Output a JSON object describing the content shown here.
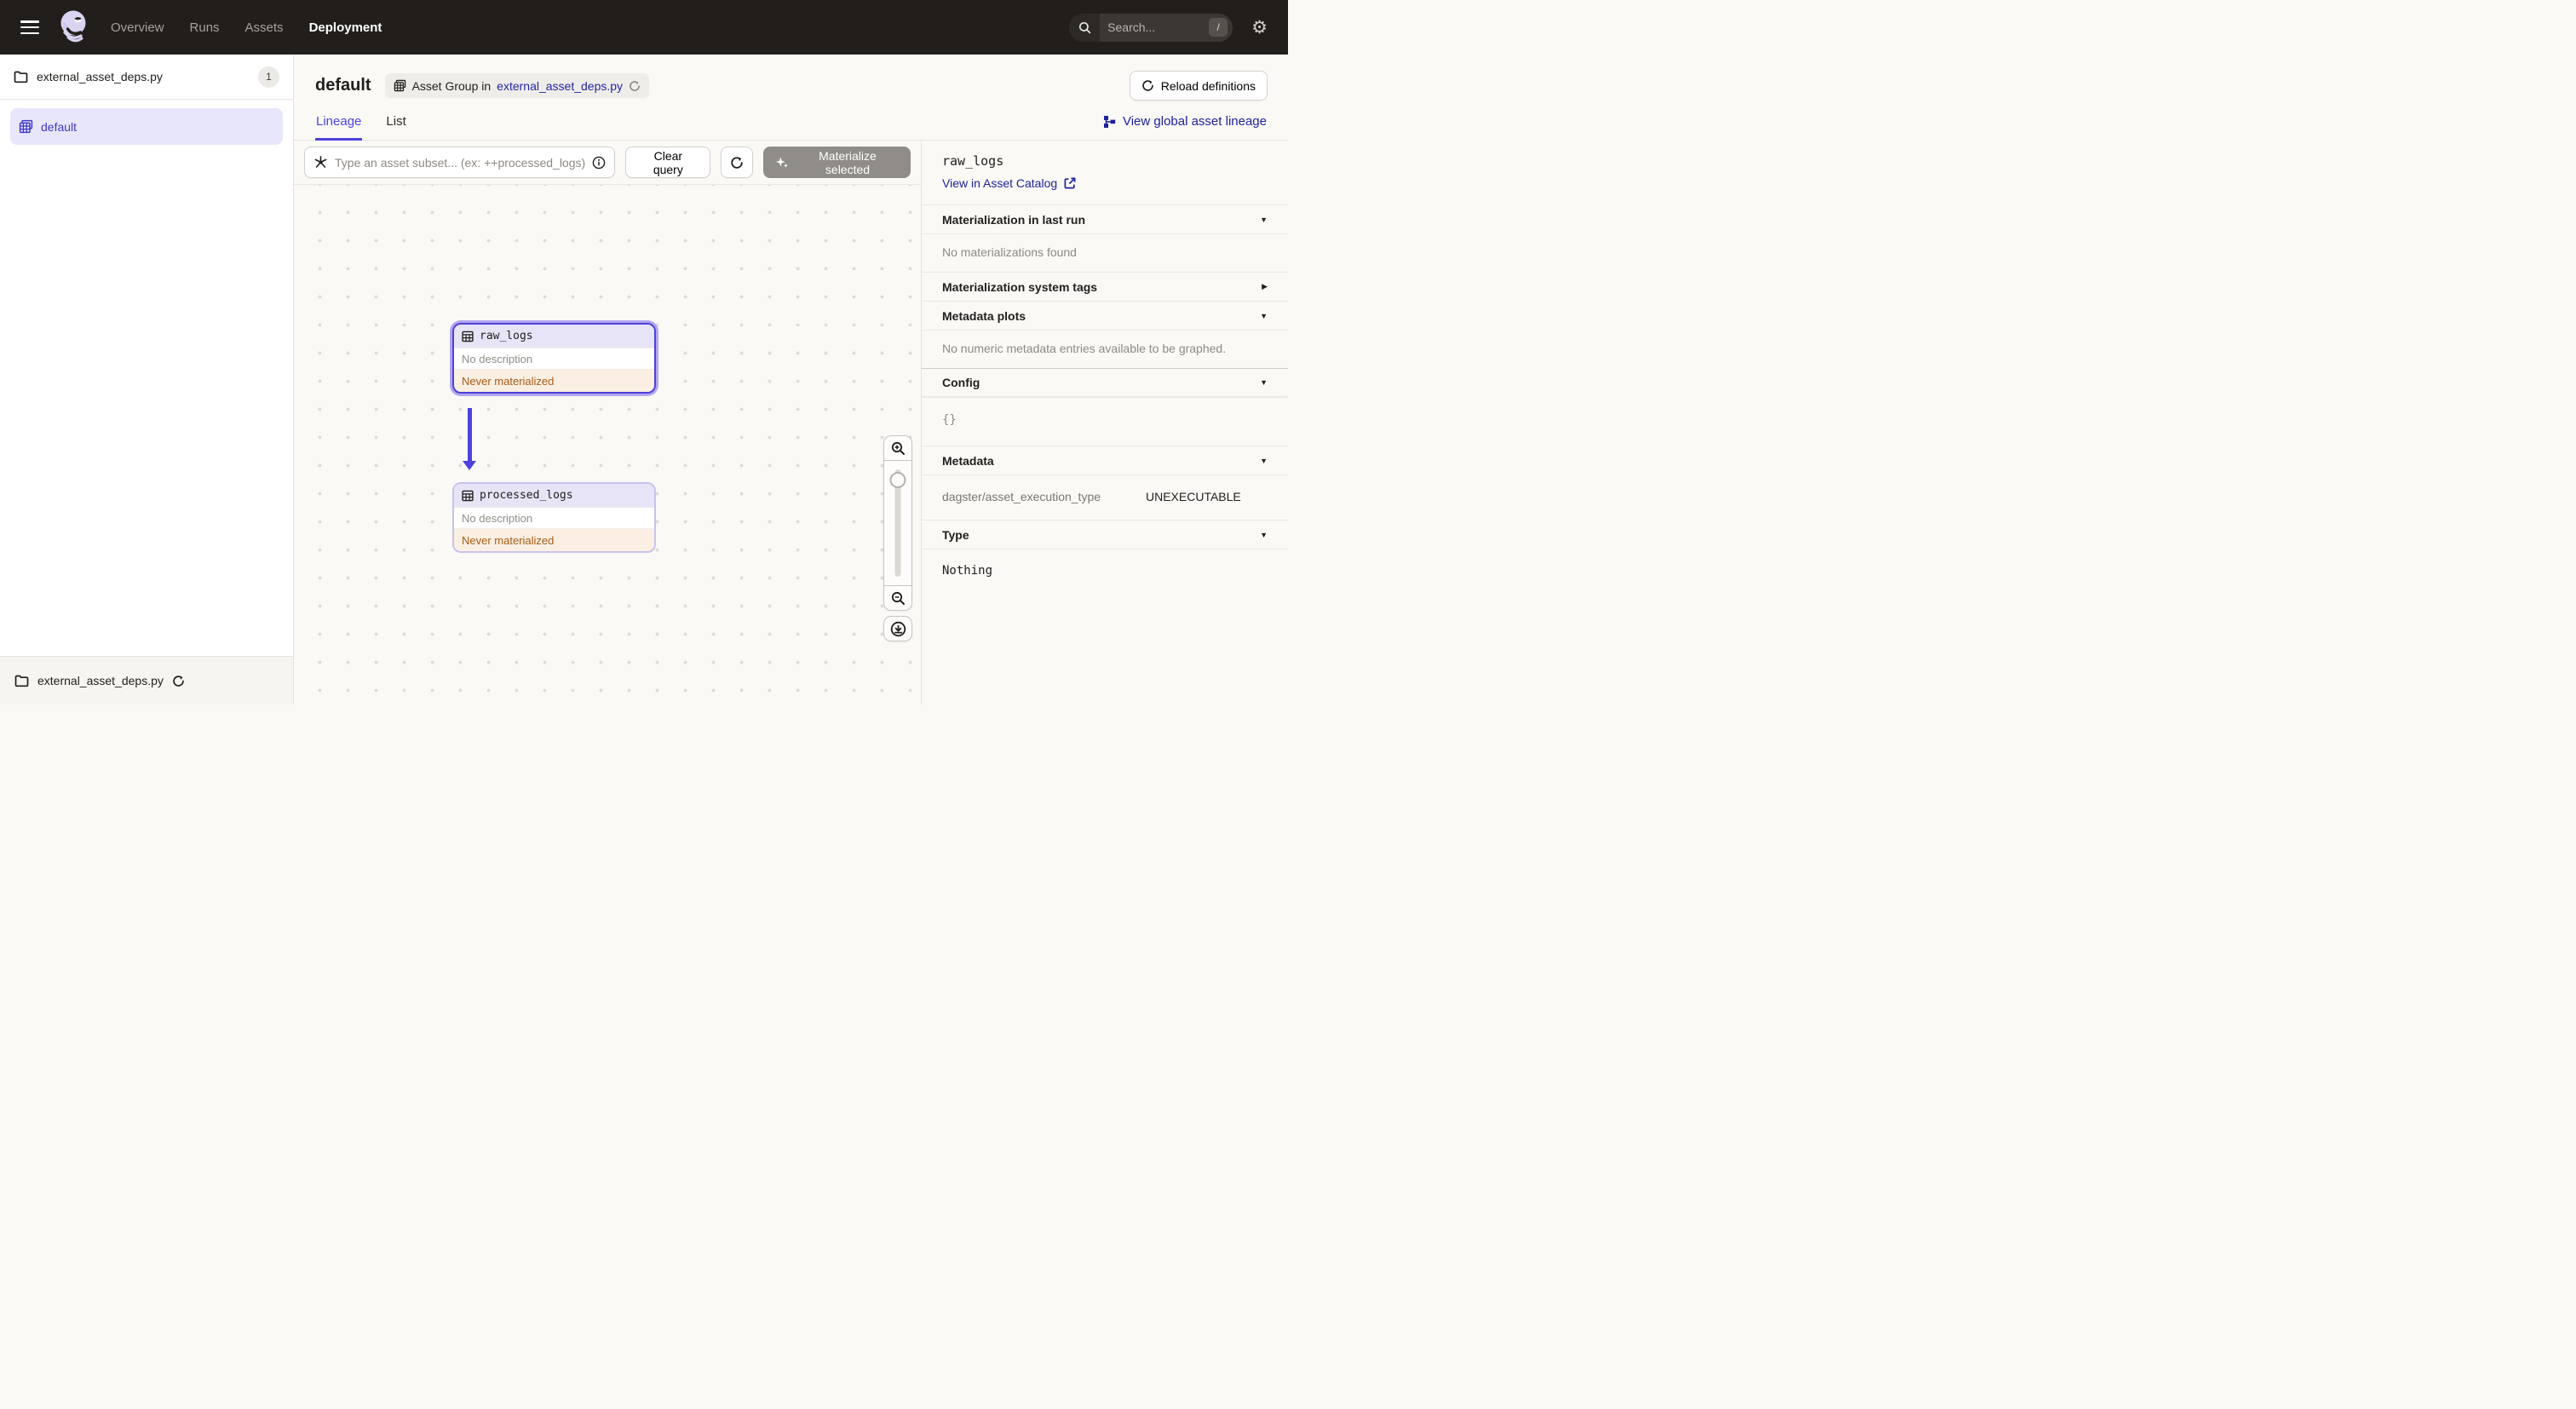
{
  "nav": {
    "items": [
      {
        "label": "Overview",
        "active": false
      },
      {
        "label": "Runs",
        "active": false
      },
      {
        "label": "Assets",
        "active": false
      },
      {
        "label": "Deployment",
        "active": true
      }
    ],
    "search_placeholder": "Search...",
    "search_shortcut": "/"
  },
  "sidebar": {
    "repo_file": "external_asset_deps.py",
    "repo_count": "1",
    "selected_group": "default",
    "footer_file": "external_asset_deps.py"
  },
  "header": {
    "title": "default",
    "group_pill_prefix": "Asset Group in",
    "group_pill_link": "external_asset_deps.py",
    "reload_button": "Reload definitions"
  },
  "tabs": {
    "lineage": "Lineage",
    "list": "List",
    "global_lineage_link": "View global asset lineage"
  },
  "toolbar": {
    "query_placeholder": "Type an asset subset... (ex: ++processed_logs)",
    "clear_button": "Clear query",
    "materialize_button": "Materialize selected"
  },
  "graph": {
    "nodes": [
      {
        "name": "raw_logs",
        "description": "No description",
        "status": "Never materialized",
        "selected": true
      },
      {
        "name": "processed_logs",
        "description": "No description",
        "status": "Never materialized",
        "selected": false
      }
    ],
    "edge": {
      "from": "raw_logs",
      "to": "processed_logs"
    }
  },
  "details": {
    "asset_name": "raw_logs",
    "catalog_link": "View in Asset Catalog",
    "sections": {
      "last_run": {
        "label": "Materialization in last run",
        "body": "No materializations found"
      },
      "system_tags": {
        "label": "Materialization system tags"
      },
      "metadata_plots": {
        "label": "Metadata plots",
        "body": "No numeric metadata entries available to be graphed."
      },
      "config": {
        "label": "Config",
        "body": "{}"
      },
      "metadata": {
        "label": "Metadata",
        "rows": [
          {
            "key": "dagster/asset_execution_type",
            "value": "UNEXECUTABLE"
          }
        ]
      },
      "type": {
        "label": "Type",
        "body": "Nothing"
      }
    }
  },
  "colors": {
    "accent": "#4F43DD",
    "link": "#1F229B",
    "nav_bg": "#221E1B",
    "status_text": "#A85B17",
    "status_bg": "#FAEFE2",
    "selection_ring": "#B2A6F0"
  }
}
